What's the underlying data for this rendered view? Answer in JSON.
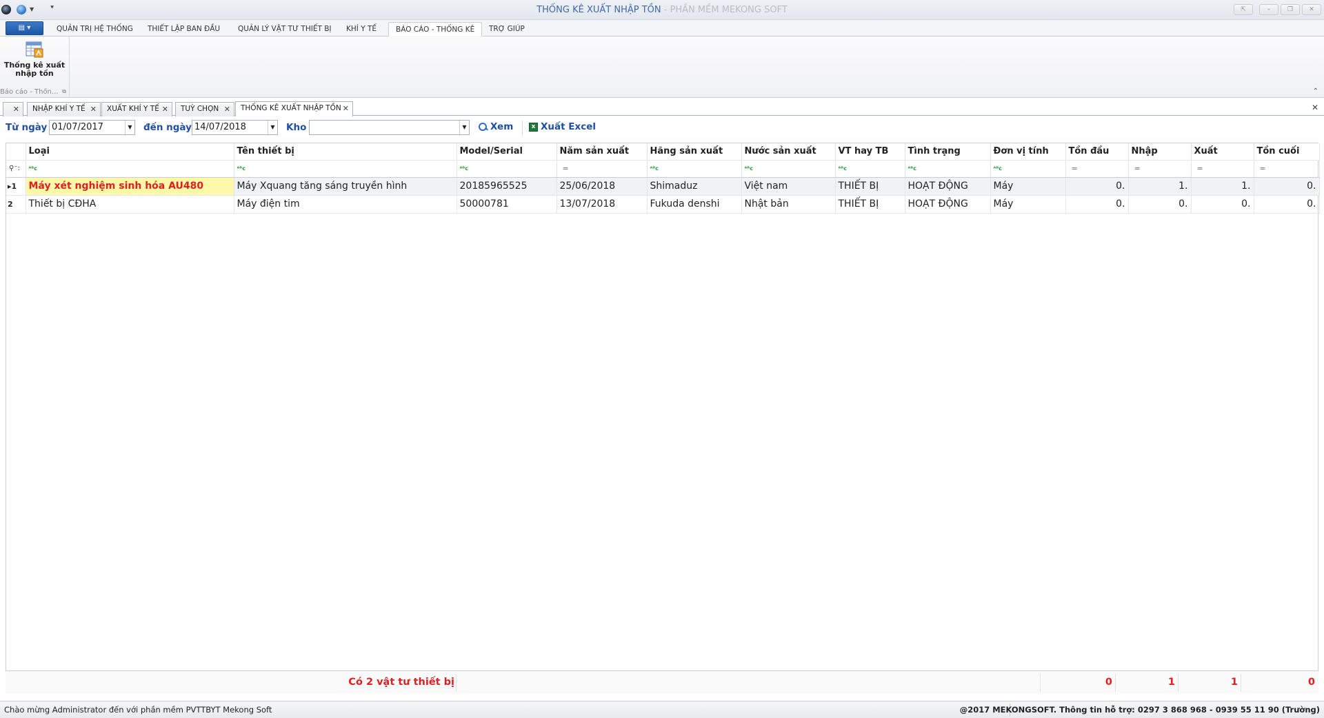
{
  "window": {
    "title": "THỐNG KÊ XUẤT NHẬP TỒN",
    "title_suffix": " - PHẦN MỀM MEKONG SOFT",
    "buttons": [
      "⇱",
      "–",
      "❐",
      "✕"
    ]
  },
  "ribbon": {
    "app_menu_label": "▤ ▾",
    "tabs": [
      {
        "label": "QUẢN TRỊ HỆ THỐNG"
      },
      {
        "label": "THIẾT LẬP BAN ĐẦU"
      },
      {
        "label": "QUẢN LÝ VẬT TƯ THIẾT BỊ"
      },
      {
        "label": "KHÍ Y TẾ"
      },
      {
        "label": "BÁO CÁO - THỐNG KÊ"
      },
      {
        "label": "TRỢ GIÚP"
      }
    ],
    "active_tab": "BÁO CÁO - THỐNG KÊ",
    "group": {
      "button_label_line1": "Thống kê xuất",
      "button_label_line2": "nhập tồn",
      "caption": "Báo cáo - Thốn...",
      "icon": "report-table-icon"
    }
  },
  "doc_tabs": [
    {
      "label": ""
    },
    {
      "label": "NHẬP KHÍ Y TẾ"
    },
    {
      "label": "XUẤT KHÍ Y TẾ"
    },
    {
      "label": "TUỲ CHỌN"
    },
    {
      "label": "THỐNG KÊ XUẤT NHẬP TỒN"
    }
  ],
  "filters": {
    "from_label": "Từ ngày",
    "from_value": "01/07/2017",
    "to_label": "đến ngày",
    "to_value": "14/07/2018",
    "kho_label": "Kho",
    "kho_value": "",
    "view_button": "Xem",
    "excel_button": "Xuất Excel"
  },
  "grid": {
    "columns": [
      "Loại",
      "Tên thiết bị",
      "Model/Serial",
      "Năm sản xuất",
      "Hãng sản xuất",
      "Nước sản xuất",
      "VT hay TB",
      "Tình trạng",
      "Đơn vị tính",
      "Tồn đầu",
      "Nhập",
      "Xuất",
      "Tồn cuối"
    ],
    "rows": [
      {
        "index": "1",
        "cells": [
          "Máy xét nghiệm sinh hóa AU480",
          "Máy Xquang tăng sáng truyền hình",
          "20185965525",
          "25/06/2018",
          "Shimaduz",
          "Việt nam",
          "THIẾT BỊ",
          "HOẠT ĐỘNG",
          "Máy",
          "0.",
          "1.",
          "1.",
          "0."
        ]
      },
      {
        "index": "2",
        "cells": [
          "Thiết bị CĐHA",
          "Máy điện tim",
          "50000781",
          "13/07/2018",
          "Fukuda denshi",
          "Nhật bản",
          "THIẾT BỊ",
          "HOẠT ĐỘNG",
          "Máy",
          "0.",
          "0.",
          "0.",
          "0."
        ]
      }
    ],
    "summary": {
      "count_text": "Có 2 vật tư thiết bị",
      "ton_dau": "0",
      "nhap": "1",
      "xuat": "1",
      "ton_cuoi": "0"
    }
  },
  "statusbar": {
    "left": "Chào mừng Administrator đến với phần mềm PVTTBYT Mekong Soft",
    "right": "@2017 MEKONGSOFT. Thông tin hỗ trợ: 0297 3 868 968 - 0939 55 11 90 (Trường)"
  }
}
